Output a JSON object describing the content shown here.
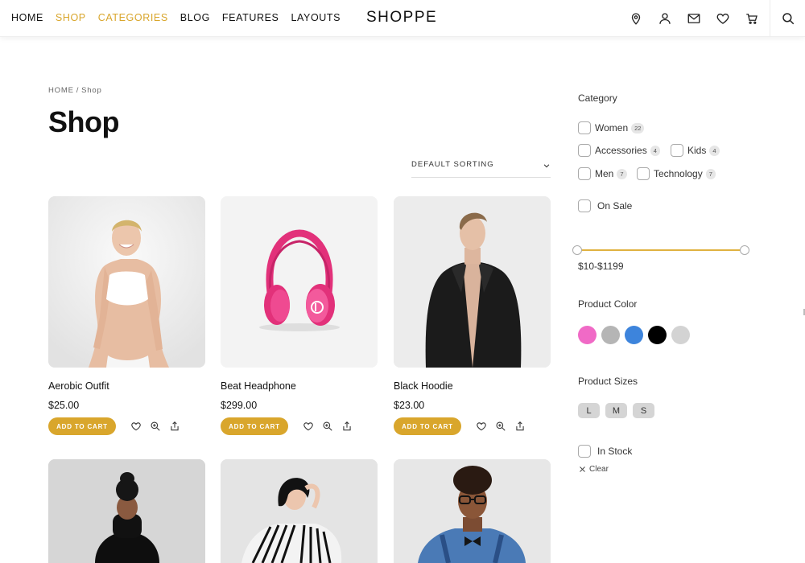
{
  "header": {
    "logo": "SHOPPE",
    "nav": [
      "HOME",
      "SHOP",
      "CATEGORIES",
      "BLOG",
      "FEATURES",
      "LAYOUTS"
    ],
    "active_nav": [
      "SHOP",
      "CATEGORIES"
    ],
    "icons": [
      "location-icon",
      "user-icon",
      "mail-icon",
      "heart-icon",
      "cart-icon",
      "search-icon"
    ]
  },
  "breadcrumb": {
    "home": "HOME",
    "separator": "/",
    "current": "Shop"
  },
  "page_title": "Shop",
  "sorting": {
    "label": "DEFAULT SORTING"
  },
  "products": [
    {
      "name": "Aerobic Outfit",
      "price": "$25.00",
      "button": "ADD TO CART"
    },
    {
      "name": "Beat Headphone",
      "price": "$299.00",
      "button": "ADD TO CART"
    },
    {
      "name": "Black Hoodie",
      "price": "$23.00",
      "button": "ADD TO CART"
    }
  ],
  "product_action_icons": [
    "heart-icon",
    "zoom-icon",
    "share-icon"
  ],
  "sidebar": {
    "category_heading": "Category",
    "categories": [
      {
        "label": "Women",
        "count": "22"
      },
      {
        "label": "Accessories",
        "count": "4"
      },
      {
        "label": "Kids",
        "count": "4"
      },
      {
        "label": "Men",
        "count": "7"
      },
      {
        "label": "Technology",
        "count": "7"
      }
    ],
    "on_sale": "On Sale",
    "price_range": "$10-$1199",
    "color_heading": "Product Color",
    "colors": [
      "#f06ac6",
      "#b5b5b5",
      "#3d84dc",
      "#000000",
      "#d3d3d3"
    ],
    "sizes_heading": "Product Sizes",
    "sizes": [
      "L",
      "M",
      "S"
    ],
    "in_stock": "In Stock",
    "clear": "Clear"
  },
  "accent_color": "#d9a62c"
}
